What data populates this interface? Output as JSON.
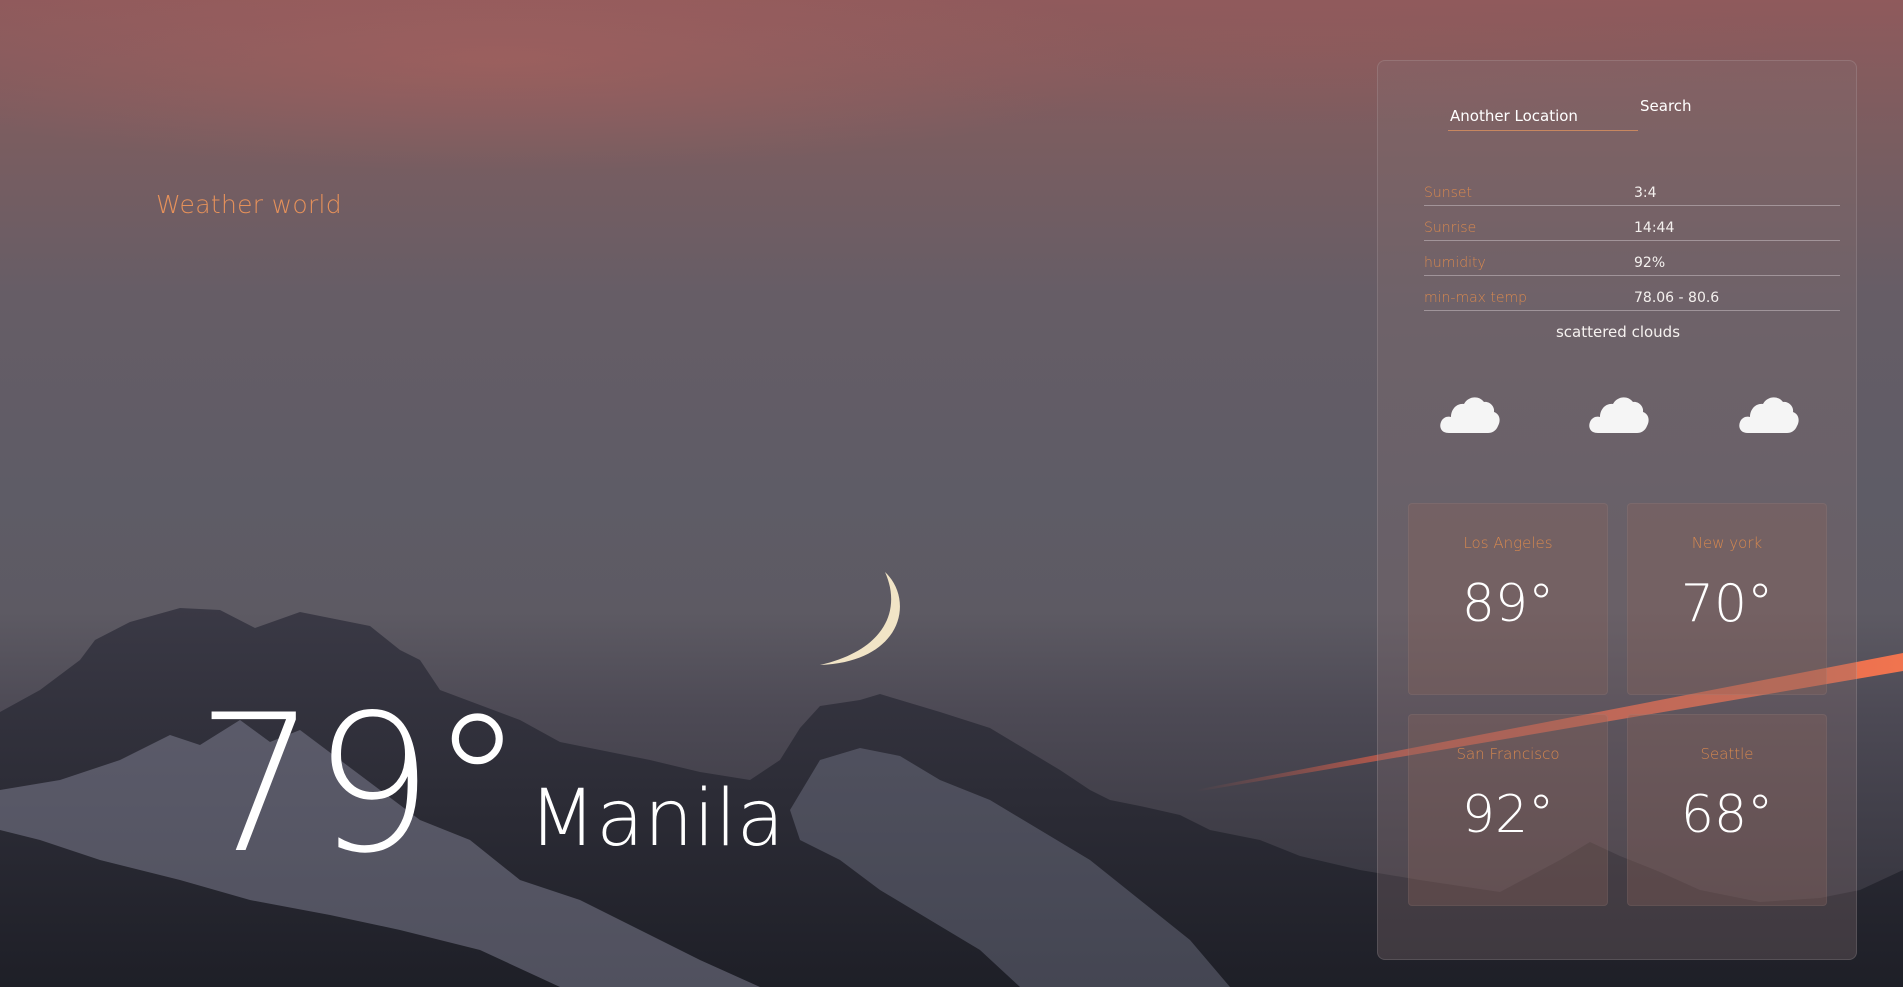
{
  "brand": {
    "title": "Weather world"
  },
  "current": {
    "temperature": "79°",
    "city": "Manila"
  },
  "search": {
    "placeholder": "Another Location",
    "button_label": "Search"
  },
  "details": [
    {
      "label": "Sunset",
      "value": "3:4"
    },
    {
      "label": "Sunrise",
      "value": "14:44"
    },
    {
      "label": "humidity",
      "value": "92%"
    },
    {
      "label": "min-max temp",
      "value": "78.06 - 80.6"
    }
  ],
  "condition": "scattered clouds",
  "icons": [
    "cloud-icon",
    "cloud-icon",
    "cloud-icon"
  ],
  "cities": [
    {
      "name": "Los Angeles",
      "temp": "89°"
    },
    {
      "name": "New york",
      "temp": "70°"
    },
    {
      "name": "San Francisco",
      "temp": "92°"
    },
    {
      "name": "Seattle",
      "temp": "68°"
    }
  ],
  "colors": {
    "accent": "#d7884f",
    "text": "#ffffff",
    "panel": "#826e70",
    "moon": "#f1e4c6",
    "contrail": "#e8624a",
    "mountain": "#2a2a33",
    "snow": "#8d8fa2"
  }
}
